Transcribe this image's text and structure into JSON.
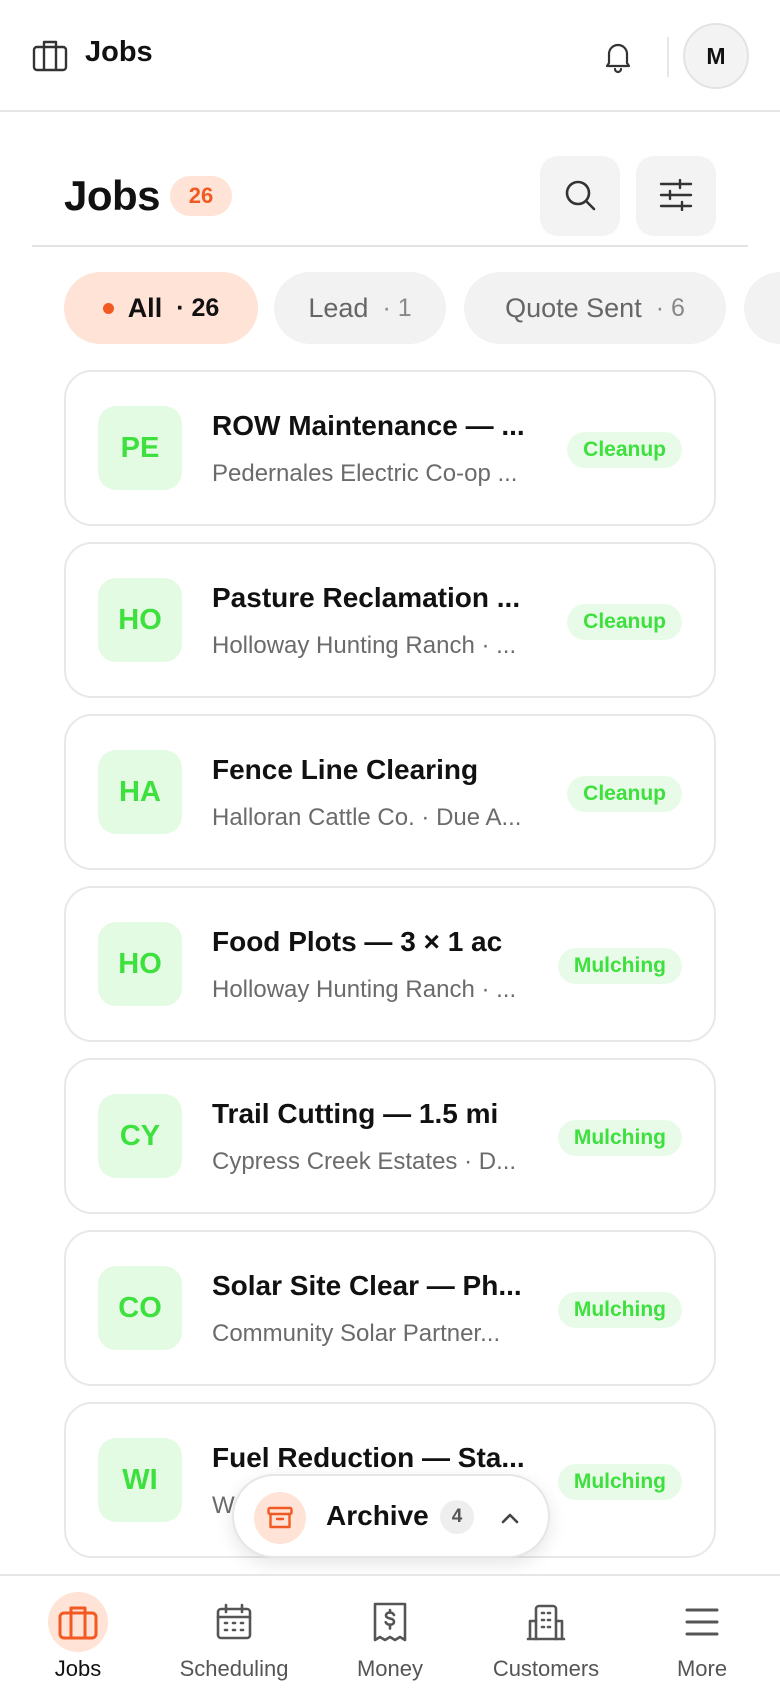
{
  "app_bar": {
    "title": "Jobs",
    "avatar_initial": "M"
  },
  "header": {
    "title": "Jobs",
    "count": "26"
  },
  "filters": [
    {
      "label": "All",
      "count": "· 26",
      "active": true
    },
    {
      "label": "Lead",
      "count": "· 1",
      "active": false
    },
    {
      "label": "Quote Sent",
      "count": "· 6",
      "active": false
    }
  ],
  "jobs": [
    {
      "initials": "PE",
      "title": "ROW Maintenance — ...",
      "subtitle": "Pedernales Electric Co-op ...",
      "tag": "Cleanup"
    },
    {
      "initials": "HO",
      "title": "Pasture Reclamation ...",
      "subtitle": "Holloway Hunting Ranch · ...",
      "tag": "Cleanup"
    },
    {
      "initials": "HA",
      "title": "Fence Line Clearing",
      "subtitle": "Halloran Cattle Co. · Due A...",
      "tag": "Cleanup"
    },
    {
      "initials": "HO",
      "title": "Food Plots — 3 × 1 ac",
      "subtitle": "Holloway Hunting Ranch · ...",
      "tag": "Mulching"
    },
    {
      "initials": "CY",
      "title": "Trail Cutting — 1.5 mi",
      "subtitle": "Cypress Creek Estates · D...",
      "tag": "Mulching"
    },
    {
      "initials": "CO",
      "title": "Solar Site Clear — Ph...",
      "subtitle": "Community Solar Partner...",
      "tag": "Mulching"
    },
    {
      "initials": "WI",
      "title": "Fuel Reduction — Sta...",
      "subtitle": "W",
      "tag": "Mulching"
    }
  ],
  "archive": {
    "label": "Archive",
    "count": "4"
  },
  "tabs": [
    {
      "label": "Jobs",
      "icon": "briefcase-icon",
      "active": true
    },
    {
      "label": "Scheduling",
      "icon": "calendar-icon",
      "active": false
    },
    {
      "label": "Money",
      "icon": "receipt-dollar-icon",
      "active": false
    },
    {
      "label": "Customers",
      "icon": "building-icon",
      "active": false
    },
    {
      "label": "More",
      "icon": "menu-icon",
      "active": false
    }
  ],
  "colors": {
    "accent": "#f15a22",
    "accent_soft": "#ffe3d6",
    "green": "#3ee03e",
    "green_soft": "#e3fbe3"
  }
}
